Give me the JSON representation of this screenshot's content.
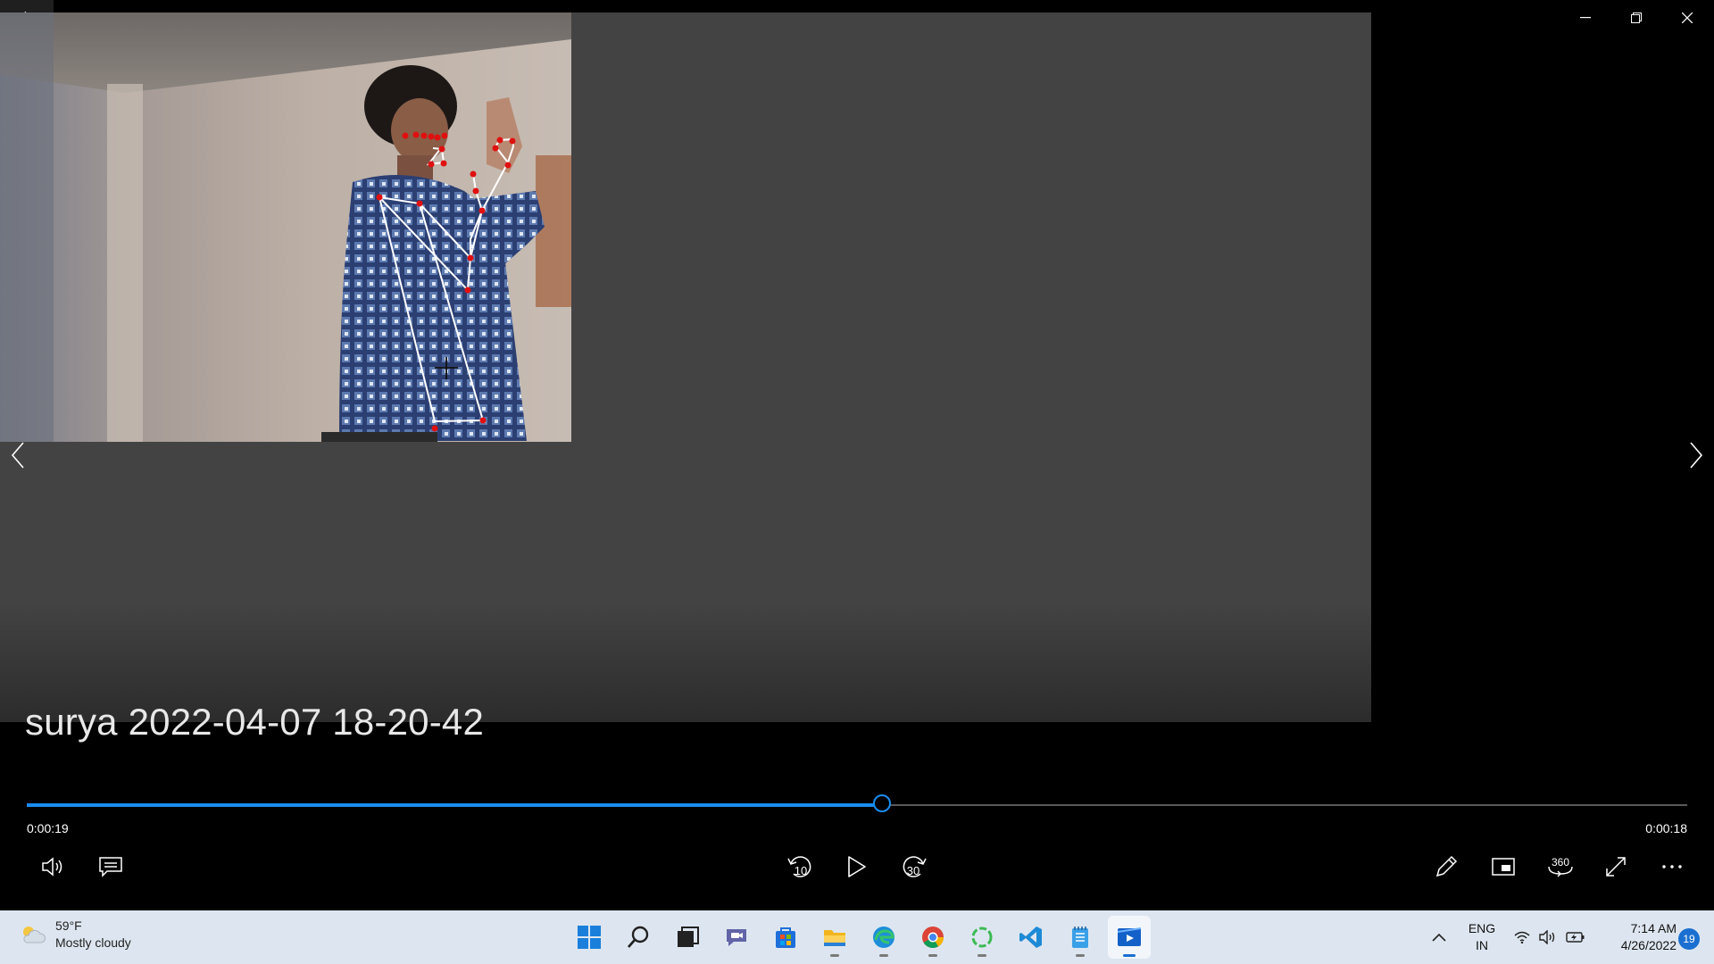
{
  "video": {
    "title": "surya 2022-04-07 18-20-42",
    "elapsed": "0:00:19",
    "remaining": "0:00:18",
    "progress_fraction": 0.515,
    "accent_color": "#1a8cf0"
  },
  "controls": {
    "skip_back_seconds": "10",
    "skip_forward_seconds": "30",
    "view_360_label": "360"
  },
  "taskbar": {
    "weather": {
      "temperature": "59°F",
      "condition": "Mostly cloudy"
    },
    "language": {
      "line1": "ENG",
      "line2": "IN"
    },
    "clock": {
      "time": "7:14 AM",
      "date": "4/26/2022"
    },
    "notification_count": "19",
    "apps": [
      "start-icon",
      "search-icon",
      "task-view-icon",
      "teams-chat-icon",
      "microsoft-store-icon",
      "file-explorer-icon",
      "edge-icon",
      "chrome-icon",
      "loading-app-icon",
      "vscode-icon",
      "notepad-icon",
      "movies-tv-icon"
    ]
  }
}
